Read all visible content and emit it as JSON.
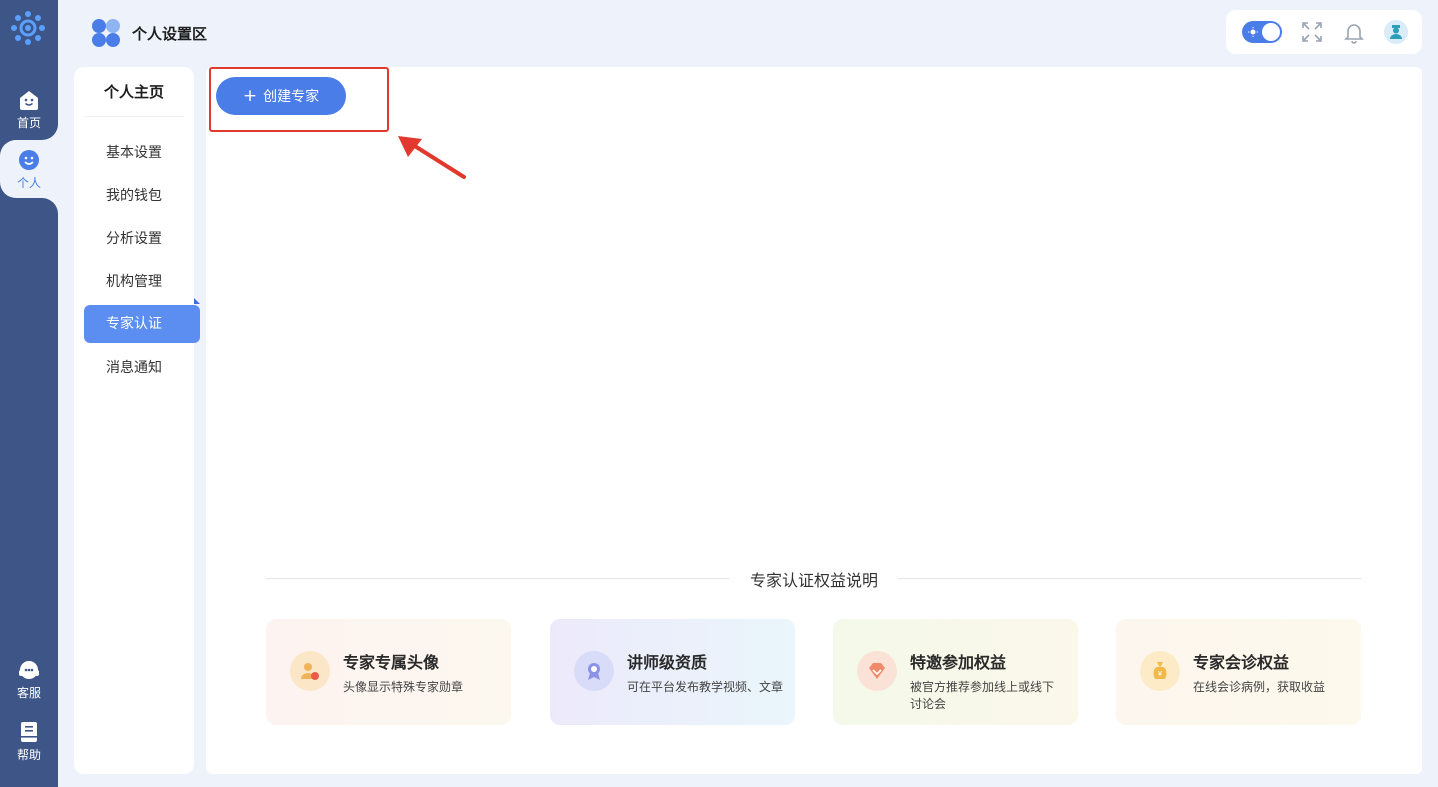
{
  "rail": {
    "items": [
      {
        "label": "首页",
        "icon": "home-icon"
      },
      {
        "label": "个人",
        "icon": "smile-icon"
      },
      {
        "label": "客服",
        "icon": "headset-icon"
      },
      {
        "label": "帮助",
        "icon": "book-icon"
      }
    ],
    "active_color": "#4a7de8",
    "bg_color": "#3e5687"
  },
  "header": {
    "title": "个人设置区",
    "tools": [
      "theme-toggle",
      "fullscreen-icon",
      "bell-icon",
      "user-avatar"
    ]
  },
  "subnav": {
    "title": "个人主页",
    "items": [
      {
        "label": "基本设置"
      },
      {
        "label": "我的钱包"
      },
      {
        "label": "分析设置"
      },
      {
        "label": "机构管理"
      },
      {
        "label": "专家认证",
        "active": true
      },
      {
        "label": "消息通知"
      }
    ]
  },
  "main": {
    "create_button": "创建专家",
    "benefits_title": "专家认证权益说明",
    "benefits": [
      {
        "title": "专家专属头像",
        "desc": "头像显示特殊专家勋章",
        "icon": "expert-avatar-icon"
      },
      {
        "title": "讲师级资质",
        "desc": "可在平台发布教学视频、文章",
        "icon": "medal-icon"
      },
      {
        "title": "特邀参加权益",
        "desc": "被官方推荐参加线上或线下讨论会",
        "icon": "diamond-icon"
      },
      {
        "title": "专家会诊权益",
        "desc": "在线会诊病例，获取收益",
        "icon": "money-bag-icon"
      }
    ]
  }
}
